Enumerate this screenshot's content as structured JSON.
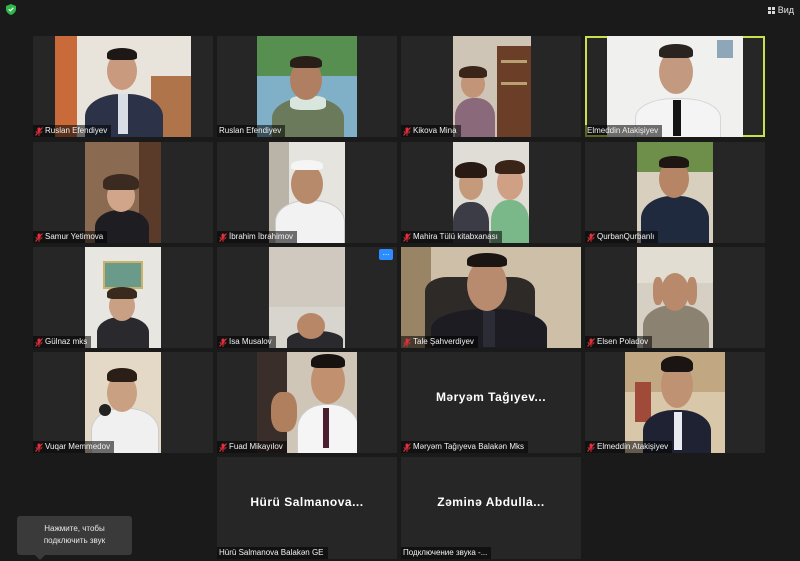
{
  "toolbar": {
    "view_label": "Вид",
    "view_icon": "grid-icon",
    "security_icon": "shield-icon",
    "accent": "#2fb84a"
  },
  "tiles": [
    {
      "name": "Ruslan Efendiyev",
      "muted": true
    },
    {
      "name": "Ruslan Efendiyev",
      "muted": false
    },
    {
      "name": "Kikova Mina",
      "muted": true
    },
    {
      "name": "Elmeddin Atakişiyev",
      "muted": false,
      "active": true
    },
    {
      "name": "Samur Yetimova",
      "muted": true
    },
    {
      "name": "İbrahim İbrahimov",
      "muted": true
    },
    {
      "name": "Mahira Tülü kitabxanası",
      "muted": true
    },
    {
      "name": "QurbanQurbanlı",
      "muted": true
    },
    {
      "name": "Gülnaz mks",
      "muted": true
    },
    {
      "name": "Isa Musalov",
      "muted": true
    },
    {
      "name": "Tale Şahverdiyev",
      "muted": true
    },
    {
      "name": "Elsen Poladov",
      "muted": true
    },
    {
      "name": "Vuqar Memmedov",
      "muted": true
    },
    {
      "name": "Fuad Mikayılov",
      "muted": true
    },
    {
      "name": "Məryəm Tağıyeva Balakən Mks",
      "muted": true,
      "display": "Məryəm Tağıyev..."
    },
    {
      "name": "Elmeddin Atakişiyev",
      "muted": true
    },
    {
      "name": "Hürü Salmanova Balakən GE",
      "muted": false,
      "display": "Hürü Salmanova..."
    },
    {
      "name": "Подключение звука -...",
      "muted": false,
      "display": "Zəminə Abdulla..."
    }
  ],
  "more_button": "...",
  "tooltip": {
    "line1": "Нажмите, чтобы",
    "line2": "подключить звук"
  },
  "colors": {
    "mic_off": "#e0303a",
    "active_border": "#c8e04a",
    "more_btn": "#2d8cff"
  }
}
